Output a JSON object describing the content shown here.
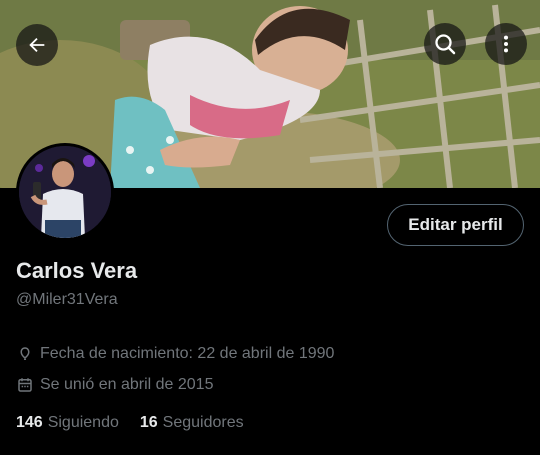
{
  "header": {
    "back_icon": "arrow-left-icon",
    "search_icon": "search-icon",
    "more_icon": "more-vertical-icon"
  },
  "profile": {
    "name": "Carlos Vera",
    "handle": "@Miler31Vera",
    "edit_button_label": "Editar perfil",
    "birth_icon": "balloon-icon",
    "birth_text": "Fecha de nacimiento: 22 de abril de 1990",
    "joined_icon": "calendar-icon",
    "joined_text": "Se unió en abril de 2015",
    "following_count": "146",
    "following_label": "Siguiendo",
    "followers_count": "16",
    "followers_label": "Seguidores"
  },
  "colors": {
    "background": "#000000",
    "primary_text": "#e7e9ea",
    "secondary_text": "#71767b",
    "button_border": "#536471"
  }
}
